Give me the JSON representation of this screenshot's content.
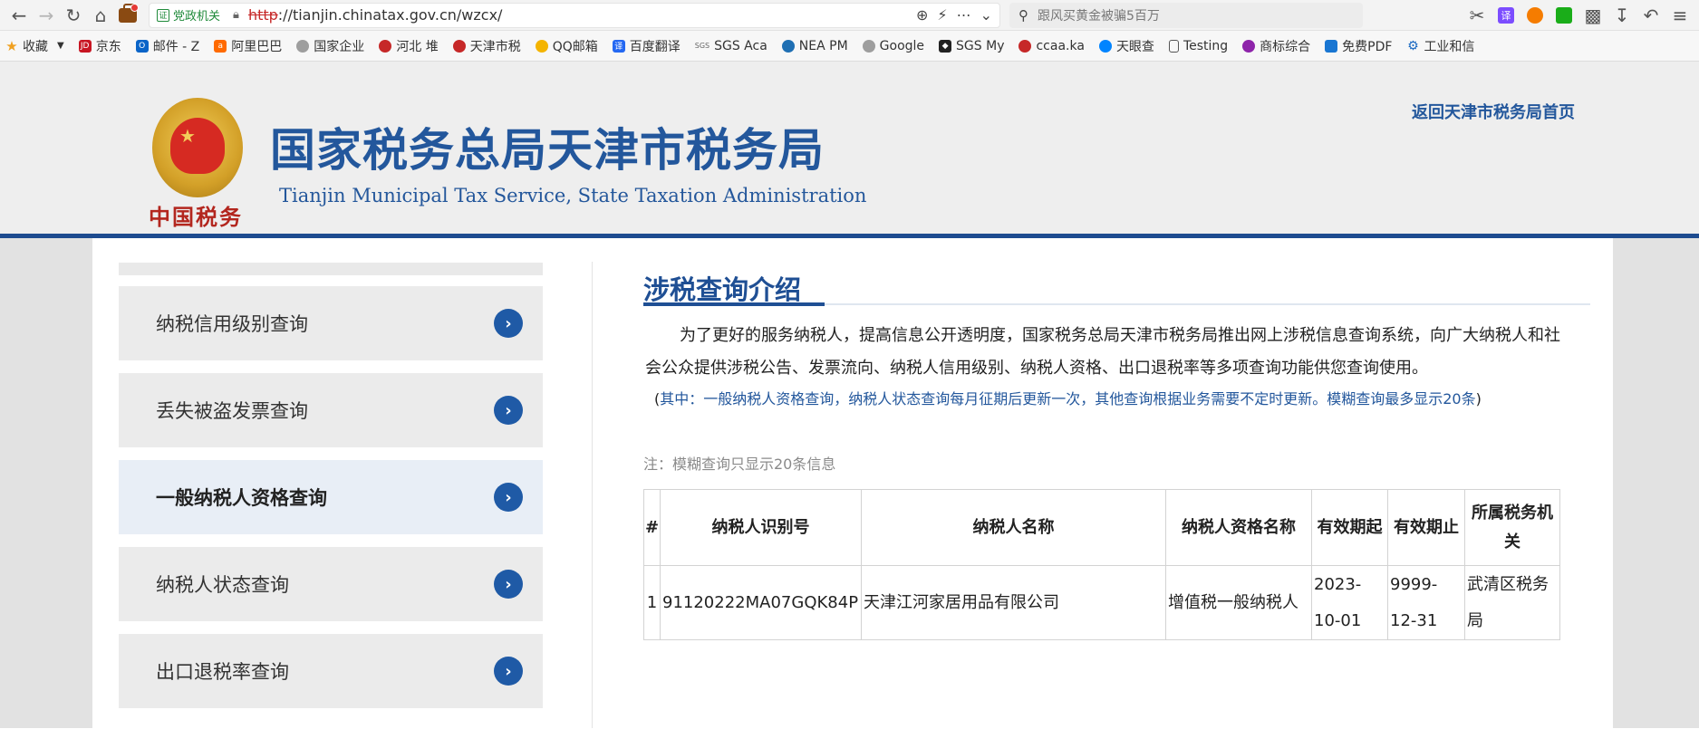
{
  "browser": {
    "cert_label": "党政机关",
    "url_protocol": "http",
    "url_rest": "://tianjin.chinatax.gov.cn/wzcx/",
    "search_placeholder": "跟风买黄金被骗5百万",
    "icons": [
      "back-icon",
      "forward-icon",
      "reload-icon",
      "home-icon",
      "briefcase-icon",
      "zoom-icon",
      "lightning-icon",
      "more-icon",
      "chevron-down-icon",
      "search-icon",
      "scissors-icon",
      "translate-icon",
      "fox-icon",
      "wechat-icon",
      "puzzle-icon",
      "download-icon",
      "undo-icon",
      "menu-icon"
    ]
  },
  "bookmarks": [
    {
      "label": "收藏",
      "icon": "star-icon",
      "color": "#f0a020"
    },
    {
      "label": "京东",
      "icon": "jd-icon",
      "color": "#c81623"
    },
    {
      "label": "邮件 - Z",
      "icon": "outlook-icon",
      "color": "#0a64c8"
    },
    {
      "label": "阿里巴巴",
      "icon": "alibaba-icon",
      "color": "#ff6a00"
    },
    {
      "label": "国家企业",
      "icon": "globe-icon",
      "color": "#888888"
    },
    {
      "label": "河北 堆",
      "icon": "emblem-icon",
      "color": "#c62828"
    },
    {
      "label": "天津市税",
      "icon": "emblem-icon",
      "color": "#c62828"
    },
    {
      "label": "QQ邮箱",
      "icon": "qq-icon",
      "color": "#f4b400"
    },
    {
      "label": "百度翻译",
      "icon": "baidu-translate-icon",
      "color": "#2468f2"
    },
    {
      "label": "SGS Aca",
      "icon": "sgs-icon",
      "color": "#666666"
    },
    {
      "label": "NEA PM",
      "icon": "nea-icon",
      "color": "#1f6fb3"
    },
    {
      "label": "Google",
      "icon": "globe-icon",
      "color": "#888888"
    },
    {
      "label": "SGS My",
      "icon": "sgs-icon",
      "color": "#222222"
    },
    {
      "label": "ccaa.ka",
      "icon": "ccaa-icon",
      "color": "#c62828"
    },
    {
      "label": "天眼查",
      "icon": "tianyancha-icon",
      "color": "#0084ff"
    },
    {
      "label": "Testing",
      "icon": "document-icon",
      "color": "#555555"
    },
    {
      "label": "商标综合",
      "icon": "trademark-icon",
      "color": "#8e24aa"
    },
    {
      "label": "免费PDF",
      "icon": "pdf-icon",
      "color": "#1976d2"
    },
    {
      "label": "工业和信",
      "icon": "gear-icon",
      "color": "#1565c0"
    }
  ],
  "header": {
    "title": "国家税务总局天津市税务局",
    "subtitle": "Tianjin Municipal Tax Service, State Taxation Administration",
    "emblem_text": "中国税务",
    "home_link": "返回天津市税务局首页",
    "accent": "#1d4b8f"
  },
  "sidebar": {
    "items": [
      {
        "label": "纳税信用级别查询",
        "active": false
      },
      {
        "label": "丢失被盗发票查询",
        "active": false
      },
      {
        "label": "一般纳税人资格查询",
        "active": true
      },
      {
        "label": "纳税人状态查询",
        "active": false
      },
      {
        "label": "出口退税率查询",
        "active": false
      }
    ]
  },
  "main": {
    "section_title": "涉税查询介绍",
    "intro": "为了更好的服务纳税人，提高信息公开透明度，国家税务总局天津市税务局推出网上涉税信息查询系统，向广大纳税人和社会公众提供涉税公告、发票流向、纳税人信用级别、纳税人资格、出口退税率等多项查询功能供您查询使用。",
    "intro_note_open": "(",
    "intro_note": "其中：一般纳税人资格查询，纳税人状态查询每月征期后更新一次，其他查询根据业务需要不定时更新。模糊查询最多显示20条",
    "intro_note_close": ")",
    "note": "注：模糊查询只显示20条信息",
    "table": {
      "headers": [
        "#",
        "纳税人识别号",
        "纳税人名称",
        "纳税人资格名称",
        "有效期起",
        "有效期止",
        "所属税务机关"
      ],
      "rows": [
        [
          "1",
          "91120222MA07GQK84P",
          "天津江河家居用品有限公司",
          "增值税一般纳税人",
          "2023-10-01",
          "9999-12-31",
          "武清区税务局"
        ]
      ]
    }
  }
}
